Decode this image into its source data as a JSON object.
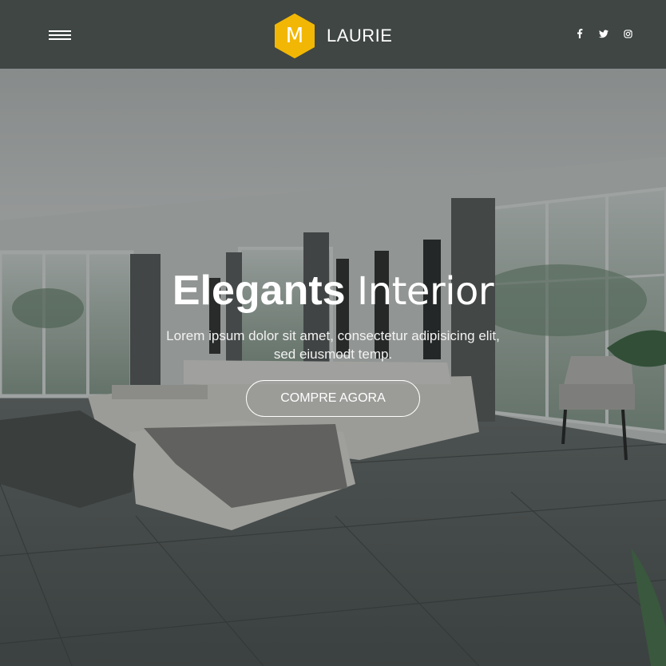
{
  "header": {
    "menu_icon": "hamburger-menu-icon",
    "logo_letter": "M",
    "brand": "LAURIE",
    "logo_color": "#F2B705",
    "background": "#3F4644",
    "social": [
      {
        "name": "facebook-icon",
        "glyph": "f"
      },
      {
        "name": "twitter-icon",
        "glyph": "t"
      },
      {
        "name": "instagram-icon",
        "glyph": "i"
      }
    ]
  },
  "hero": {
    "title_bold": "Elegants",
    "title_light": "Interior",
    "subtitle_line1": "Lorem ipsum dolor sit amet, consectetur adipisicing elit,",
    "subtitle_line2": "sed eiusmodt temp.",
    "cta_label": "COMPRE AGORA",
    "background_image": "living room interior photo"
  }
}
